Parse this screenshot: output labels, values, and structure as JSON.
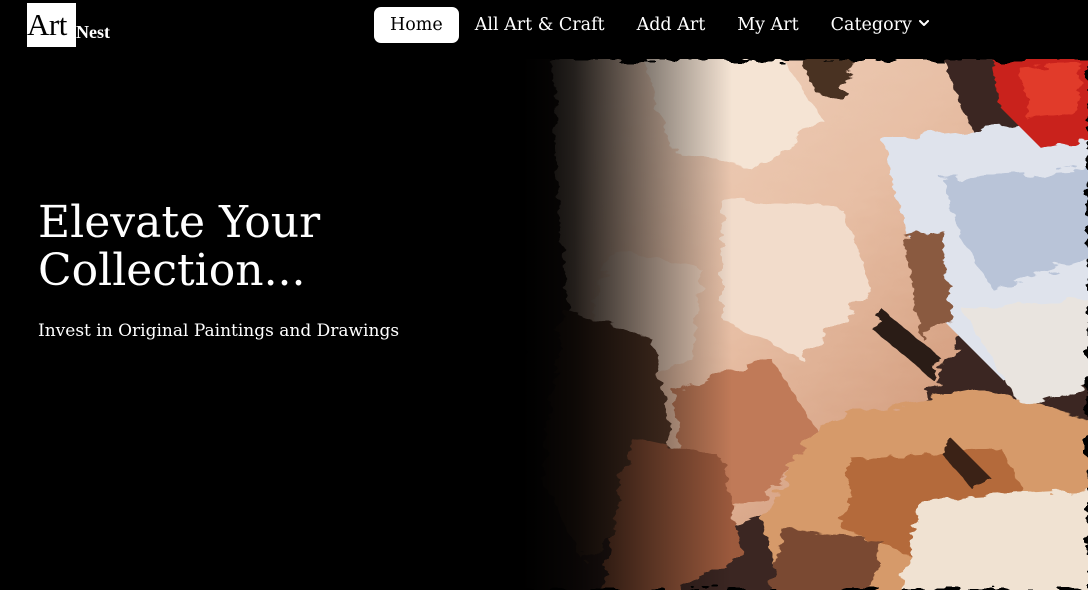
{
  "brand": {
    "logo_main": "Art",
    "logo_sub": "Nest"
  },
  "nav": {
    "items": [
      {
        "label": "Home",
        "active": true
      },
      {
        "label": "All Art & Craft",
        "active": false
      },
      {
        "label": "Add Art",
        "active": false
      },
      {
        "label": "My Art",
        "active": false
      },
      {
        "label": "Category",
        "active": false,
        "icon": "chevron-down-icon"
      }
    ]
  },
  "hero": {
    "title_line1": "Elevate Your",
    "title_line2": "Collection...",
    "subtitle": "Invest in Original Paintings and Drawings",
    "image_subject": "oil-painting-close-up"
  },
  "colors": {
    "background": "#000000",
    "nav_active_bg": "#ffffff",
    "text": "#ffffff",
    "accent_red": "#c9231b"
  }
}
